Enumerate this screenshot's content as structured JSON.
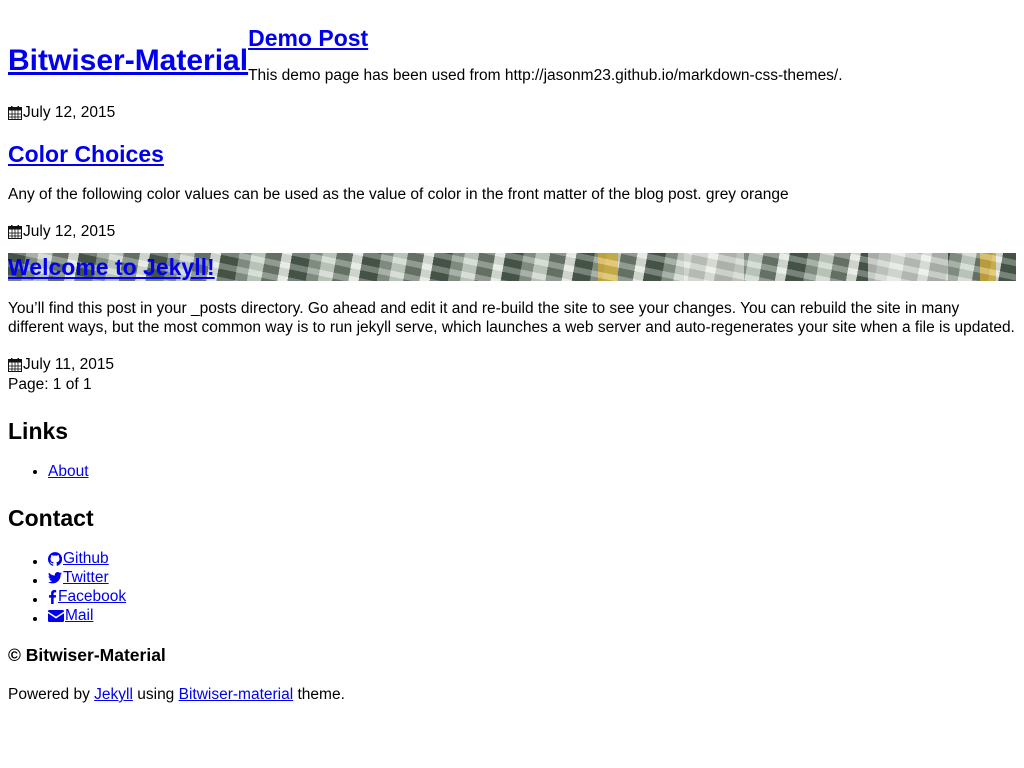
{
  "site": {
    "title": "Bitwiser-Material"
  },
  "header_post": {
    "title": "Demo Post",
    "excerpt": "This demo page has been used from http://jasonm23.github.io/markdown-css-themes/.",
    "date": "July 12, 2015"
  },
  "posts": [
    {
      "title": "Color Choices",
      "excerpt": "Any of the following color values can be used as the value of color in the front matter of the blog post. grey orange",
      "date": "July 12, 2015"
    },
    {
      "title": "Welcome to Jekyll!",
      "excerpt": "You’ll find this post in your _posts directory. Go ahead and edit it and re-build the site to see your changes. You can rebuild the site in many different ways, but the most common way is to run jekyll serve, which launches a web server and auto-regenerates your site when a file is updated.",
      "date": "July 11, 2015"
    }
  ],
  "pager": {
    "text": "Page: 1 of 1"
  },
  "links": {
    "heading": "Links",
    "items": [
      {
        "label": "About"
      }
    ]
  },
  "contact": {
    "heading": "Contact",
    "items": [
      {
        "label": "Github",
        "icon": "github-icon"
      },
      {
        "label": "Twitter",
        "icon": "twitter-icon"
      },
      {
        "label": "Facebook",
        "icon": "facebook-icon"
      },
      {
        "label": "Mail",
        "icon": "mail-icon"
      }
    ]
  },
  "footer": {
    "copyright": "© Bitwiser-Material",
    "powered_prefix": "Powered by",
    "jekyll_link": "Jekyll",
    "using": "using",
    "theme_link": "Bitwiser-material",
    "suffix": "theme."
  },
  "icons": {
    "date": "calendar-icon"
  }
}
